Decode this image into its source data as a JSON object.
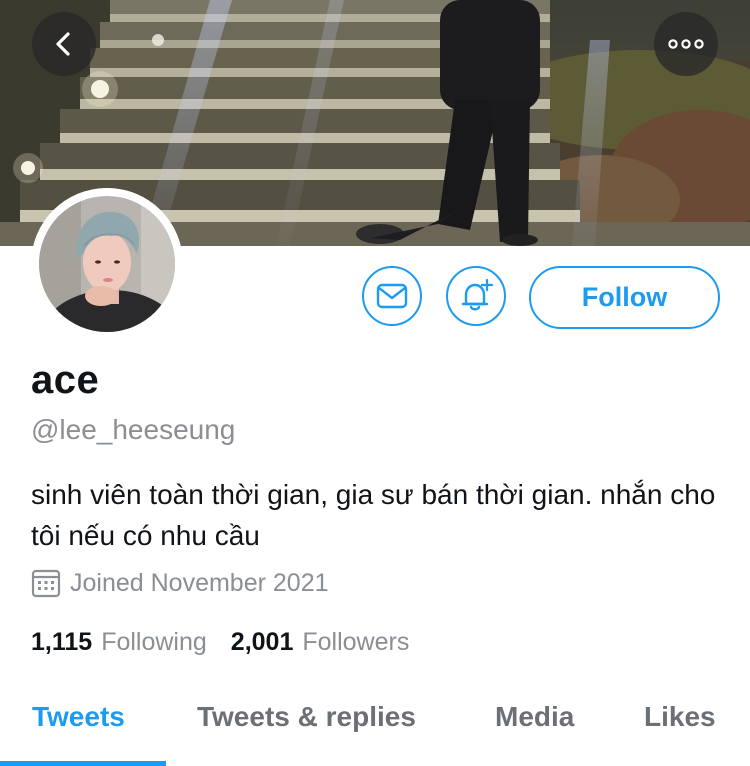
{
  "profile": {
    "display_name": "ace",
    "handle": "@lee_heeseung",
    "bio": "sinh viên toàn thời gian, gia sư bán thời gian. nhắn cho tôi nếu có nhu cầu",
    "joined": "Joined November 2021"
  },
  "stats": {
    "following_count": "1,115",
    "following_label": "Following",
    "followers_count": "2,001",
    "followers_label": "Followers"
  },
  "actions": {
    "follow_label": "Follow",
    "message_icon": "envelope-icon",
    "notify_icon": "bell-plus-icon"
  },
  "nav": {
    "back_icon": "chevron-left-icon",
    "more_icon": "more-horizontal-icon"
  },
  "tabs": [
    {
      "label": "Tweets",
      "active": true
    },
    {
      "label": "Tweets & replies",
      "active": false
    },
    {
      "label": "Media",
      "active": false
    },
    {
      "label": "Likes",
      "active": false
    }
  ],
  "colors": {
    "accent": "#1d9bf0",
    "secondary_text": "#8a8f95",
    "primary_text": "#0f1419"
  }
}
